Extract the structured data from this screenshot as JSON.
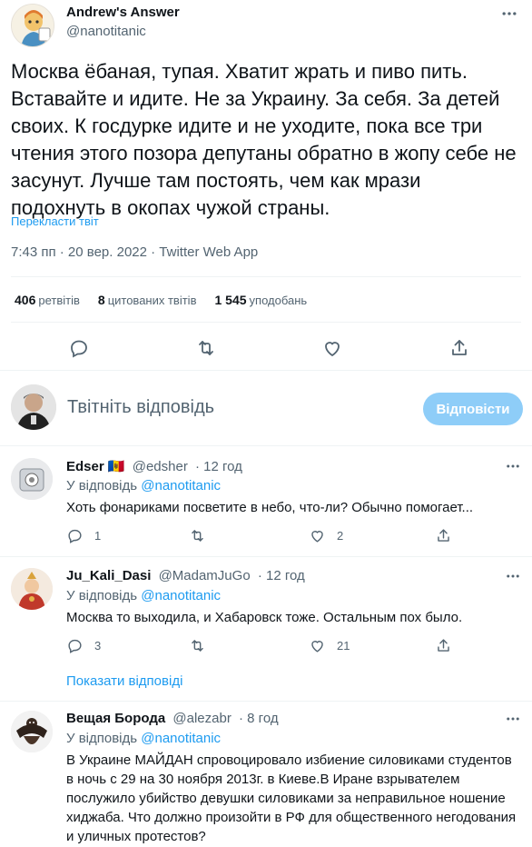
{
  "main_tweet": {
    "author_name": "Andrew's Answer",
    "author_handle": "@nanotitanic",
    "text": "Москва ёбаная, тупая. Хватит жрать и пиво пить. Вставайте и идите. Не за Украину. За себя. За детей своих. К госдурке идите и не уходите, пока все три чтения этого позора депутаны обратно в жопу себе не засунут. Лучше там постоять, чем как мрази подохнуть в окопах чужой страны.",
    "translate_label": "Перекласти твіт",
    "meta": "7:43 пп · 20 вер. 2022 · Twitter Web App",
    "stats": {
      "retweets_count": "406",
      "retweets_label": "ретвітів",
      "quotes_count": "8",
      "quotes_label": "цитованих твітів",
      "likes_count": "1 545",
      "likes_label": "уподобань"
    }
  },
  "reply_composer": {
    "placeholder": "Твітніть відповідь",
    "button_label": "Відповісти"
  },
  "replies": [
    {
      "name": "Edser",
      "flag": "🇲🇩",
      "handle": "@edsher",
      "time": "· 12 год",
      "reply_to_prefix": "У відповідь",
      "reply_to": "@nanotitanic",
      "text": "Хоть фонариками посветите в небо, что-ли? Обычно помогает...",
      "reply_count": "1",
      "retweet_count": "",
      "like_count": "2"
    },
    {
      "name": "Ju_Kali_Dasi",
      "handle": "@MadamJuGo",
      "time": "· 12 год",
      "reply_to_prefix": "У відповідь",
      "reply_to": "@nanotitanic",
      "text": "Москва то выходила, и Хабаровск тоже. Остальным пох было.",
      "reply_count": "3",
      "retweet_count": "",
      "like_count": "21"
    },
    {
      "name": "Вещая Борода",
      "handle": "@alezabr",
      "time": "· 8 год",
      "reply_to_prefix": "У відповідь",
      "reply_to": "@nanotitanic",
      "text": "В Украине МАЙДАН спровоцировало избиение силовиками студентов в ночь с 29 на 30 ноября 2013г. в Киеве.В Иране взрывателем послужило убийство девушки силовиками за неправильное ношение хиджаба. Что должно произойти в РФ для общественного негодования и уличных протестов?"
    }
  ],
  "show_replies_label": "Показати відповіді",
  "colors": {
    "accent": "#1d9bf0",
    "muted": "#536471",
    "text": "#0f1419",
    "divider": "#eff3f4",
    "button_disabled": "#8ecdf8"
  }
}
